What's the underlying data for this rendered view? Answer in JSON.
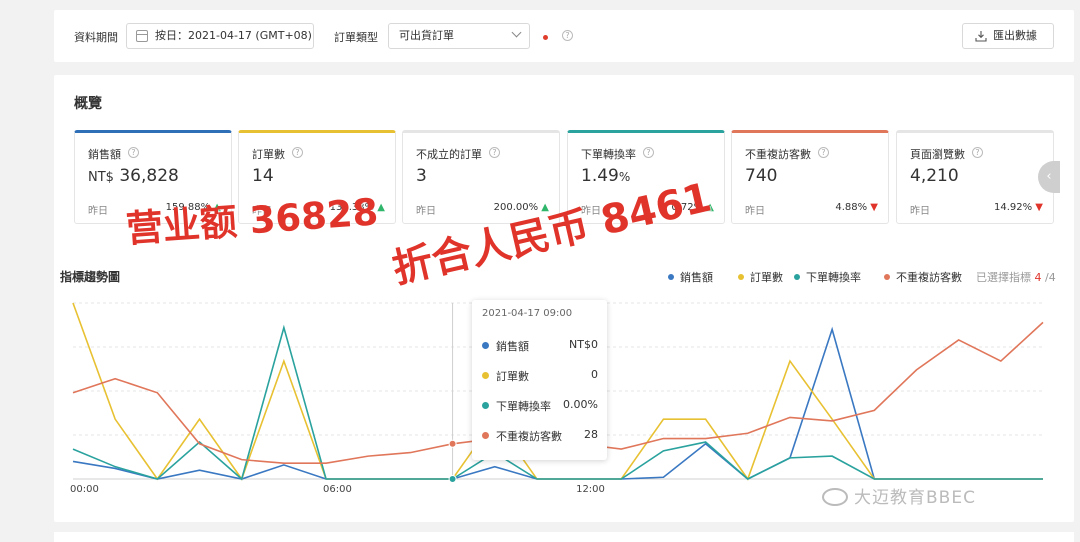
{
  "filters": {
    "period_label": "資料期間",
    "date_value": "按日：2021-04-17 (GMT+08)",
    "order_type_label": "訂單類型",
    "order_type_value": "可出貨訂單",
    "help_glyph": "?",
    "export_label": "匯出數據"
  },
  "overview": {
    "title": "概覽",
    "cards": [
      {
        "label": "銷售額",
        "currency": "NT$",
        "value": "36,828",
        "unit": "",
        "prev_label": "昨日",
        "pct": "159.88%",
        "trend": "up",
        "accent": "#2f6fb8"
      },
      {
        "label": "訂單數",
        "currency": "",
        "value": "14",
        "unit": "",
        "prev_label": "昨日",
        "pct": "133.33%",
        "trend": "up",
        "accent": "#e8c132"
      },
      {
        "label": "不成立的訂單",
        "currency": "",
        "value": "3",
        "unit": "",
        "prev_label": "昨日",
        "pct": "200.00%",
        "trend": "up",
        "accent": "#e5e5e5"
      },
      {
        "label": "下單轉換率",
        "currency": "",
        "value": "1.49",
        "unit": "%",
        "prev_label": "昨日",
        "pct": "0.72%",
        "trend": "up",
        "accent": "#2aa29e"
      },
      {
        "label": "不重複訪客數",
        "currency": "",
        "value": "740",
        "unit": "",
        "prev_label": "昨日",
        "pct": "4.88%",
        "trend": "down",
        "accent": "#e0765a"
      },
      {
        "label": "頁面瀏覽數",
        "currency": "",
        "value": "4,210",
        "unit": "",
        "prev_label": "昨日",
        "pct": "14.92%",
        "trend": "down",
        "accent": "#e5e5e5"
      }
    ],
    "arrow_glyph": "‹"
  },
  "trend": {
    "title": "指標趨勢圖",
    "legend": [
      {
        "label": "銷售額",
        "color": "#3a78c2"
      },
      {
        "label": "訂單數",
        "color": "#e8c132"
      },
      {
        "label": "下單轉換率",
        "color": "#2aa29e"
      },
      {
        "label": "不重複訪客數",
        "color": "#e0765a"
      }
    ],
    "selected_prefix": "已選擇指標",
    "selected_count": "4",
    "selected_total": "/4"
  },
  "chart_data": {
    "type": "line",
    "x": [
      "00:00",
      "01:00",
      "02:00",
      "03:00",
      "04:00",
      "05:00",
      "06:00",
      "07:00",
      "08:00",
      "09:00",
      "10:00",
      "11:00",
      "12:00",
      "13:00",
      "14:00",
      "15:00",
      "16:00",
      "17:00",
      "18:00",
      "19:00",
      "20:00",
      "21:00",
      "22:00",
      "23:00"
    ],
    "x_ticks": [
      "00:00",
      "06:00",
      "12:00"
    ],
    "series": [
      {
        "name": "銷售額",
        "color": "#3a78c2",
        "values": [
          0.1,
          0.06,
          0.0,
          0.05,
          0.0,
          0.08,
          0.0,
          0.0,
          0.0,
          0.0,
          0.07,
          0.0,
          0.0,
          0.0,
          0.01,
          0.2,
          0.0,
          0.12,
          0.85,
          0.0,
          0.0,
          0.0,
          0.0,
          0.0
        ]
      },
      {
        "name": "訂單數",
        "color": "#e8c132",
        "values": [
          1.0,
          0.34,
          0.0,
          0.34,
          0.0,
          0.67,
          0.0,
          0.0,
          0.0,
          0.0,
          0.34,
          0.0,
          0.0,
          0.0,
          0.34,
          0.34,
          0.0,
          0.67,
          0.34,
          0.0,
          0.0,
          0.0,
          0.0,
          0.0
        ]
      },
      {
        "name": "下單轉換率",
        "color": "#2aa29e",
        "values": [
          0.17,
          0.07,
          0.0,
          0.21,
          0.0,
          0.86,
          0.0,
          0.0,
          0.0,
          0.0,
          0.15,
          0.0,
          0.0,
          0.0,
          0.16,
          0.21,
          0.0,
          0.12,
          0.13,
          0.0,
          0.0,
          0.0,
          0.0,
          0.0
        ]
      },
      {
        "name": "不重複訪客數",
        "color": "#e0765a",
        "values": [
          0.49,
          0.57,
          0.49,
          0.2,
          0.11,
          0.09,
          0.09,
          0.13,
          0.15,
          0.2,
          0.23,
          0.19,
          0.2,
          0.17,
          0.23,
          0.23,
          0.26,
          0.35,
          0.33,
          0.39,
          0.62,
          0.79,
          0.67,
          0.89
        ]
      }
    ],
    "ylim": [
      0,
      1
    ],
    "grid": true,
    "tooltip": {
      "date": "2021-04-17 09:00",
      "rows": [
        {
          "label": "銷售額",
          "value": "NT$0",
          "color": "#3a78c2"
        },
        {
          "label": "訂單數",
          "value": "0",
          "color": "#e8c132"
        },
        {
          "label": "下單轉換率",
          "value": "0.00%",
          "color": "#2aa29e"
        },
        {
          "label": "不重複訪客數",
          "value": "28",
          "color": "#e0765a"
        }
      ]
    }
  },
  "annotations": {
    "revenue_note": "营业额 36828",
    "rmb_note": "折合人民币 8461"
  },
  "watermark": "大迈教育BBEC"
}
